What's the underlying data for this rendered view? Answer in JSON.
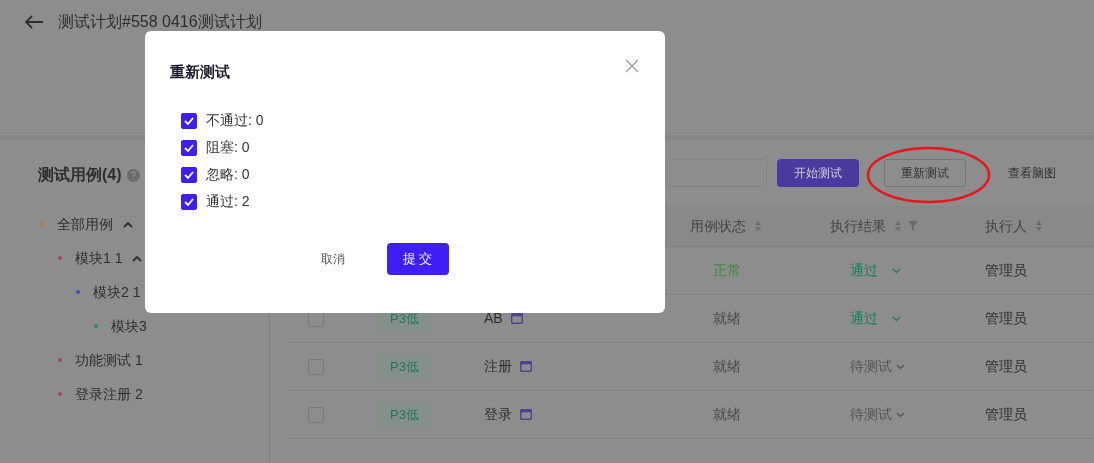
{
  "header": {
    "title": "测试计划#558 0416测试计划"
  },
  "cases_panel": {
    "title": "测试用例(4)",
    "tree": [
      {
        "label": "全部用例",
        "color": "#b07f2e",
        "expanded": true,
        "children": [
          {
            "label": "模块1 1",
            "color": "#a8444f",
            "expanded": true,
            "children": [
              {
                "label": "模块2 1",
                "color": "#2f57a0",
                "children": [
                  {
                    "label": "模块3",
                    "color": "#2a906c"
                  }
                ]
              }
            ]
          },
          {
            "label": "功能测试 1",
            "color": "#a8444f"
          },
          {
            "label": "登录注册 2",
            "color": "#a8444f"
          }
        ]
      }
    ]
  },
  "toolbar": {
    "buttons": [
      {
        "label": "开始测试",
        "kind": "primary"
      },
      {
        "label": "重新测试",
        "kind": "outline"
      },
      {
        "label": "查看脑图",
        "kind": "link"
      }
    ]
  },
  "table": {
    "columns": [
      {
        "label": "用例状态",
        "sortable": true,
        "filter": false
      },
      {
        "label": "执行结果",
        "sortable": true,
        "filter": true
      },
      {
        "label": "执行人",
        "sortable": true,
        "filter": false
      }
    ],
    "rows": [
      {
        "status": {
          "text": "正常",
          "color": "#3a8a3a"
        },
        "result": {
          "text": "通过",
          "color": "#15805e"
        },
        "executor": "管理员"
      },
      {
        "checked": false,
        "priority": "P3低",
        "name": "AB",
        "status": {
          "text": "就绪",
          "color": "#4a4a4a"
        },
        "result": {
          "text": "通过",
          "color": "#15805e"
        },
        "executor": "管理员"
      },
      {
        "checked": false,
        "priority": "P3低",
        "name": "注册",
        "status": {
          "text": "就绪",
          "color": "#4a4a4a"
        },
        "result": {
          "text": "待测试",
          "color": "#555555"
        },
        "executor": "管理员"
      },
      {
        "checked": false,
        "priority": "P3低",
        "name": "登录",
        "status": {
          "text": "就绪",
          "color": "#4a4a4a"
        },
        "result": {
          "text": "待测试",
          "color": "#555555"
        },
        "executor": "管理员"
      }
    ]
  },
  "dialog": {
    "title": "重新测试",
    "options": [
      {
        "label": "不通过: 0",
        "checked": true
      },
      {
        "label": "阻塞: 0",
        "checked": true
      },
      {
        "label": "忽略: 0",
        "checked": true
      },
      {
        "label": "通过: 2",
        "checked": true
      }
    ],
    "cancel": "取消",
    "submit": "提 交"
  }
}
